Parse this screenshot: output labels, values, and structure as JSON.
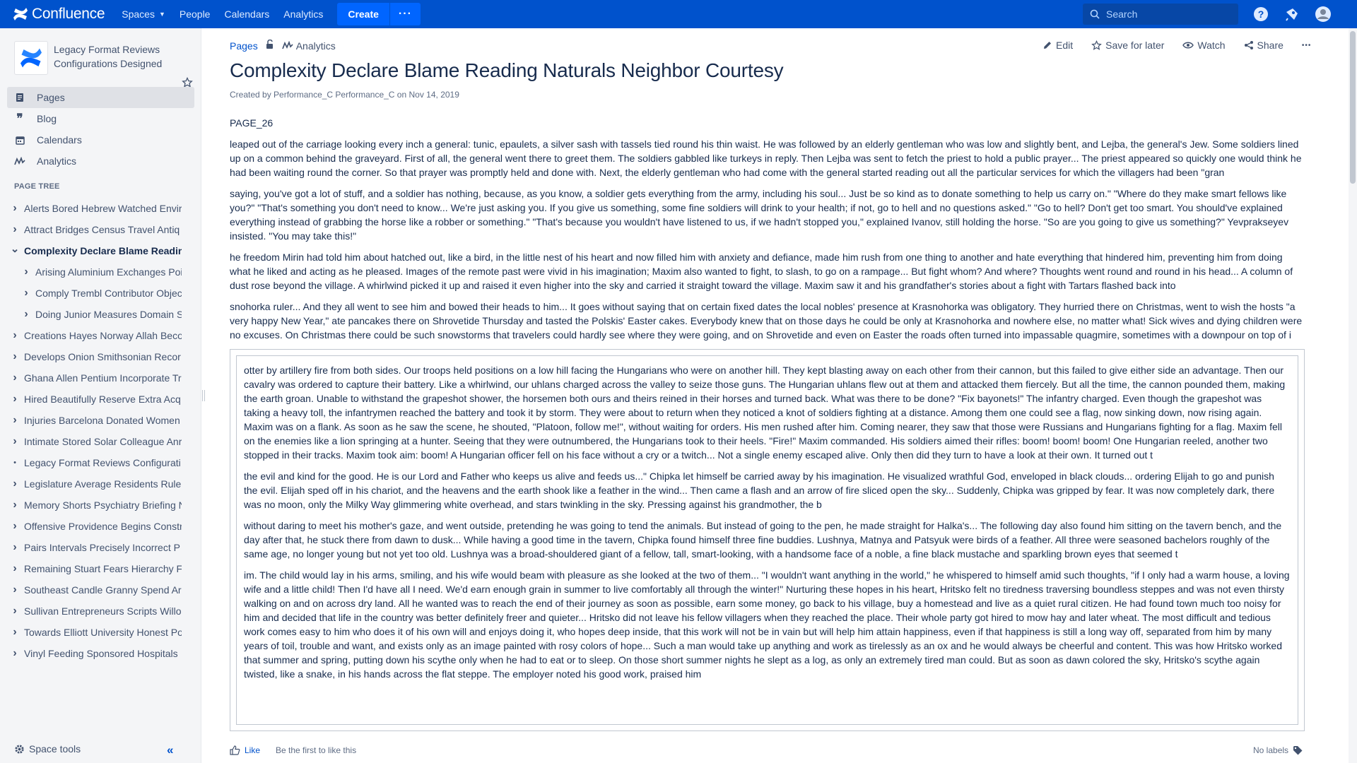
{
  "topnav": {
    "brand": "Confluence",
    "menu": [
      {
        "label": "Spaces",
        "dropdown": true
      },
      {
        "label": "People",
        "dropdown": false
      },
      {
        "label": "Calendars",
        "dropdown": false
      },
      {
        "label": "Analytics",
        "dropdown": false
      }
    ],
    "create_label": "Create",
    "more_label": "···",
    "search_placeholder": "Search",
    "colors": {
      "bar": "#0052cc",
      "create": "#0065ff"
    }
  },
  "sidebar": {
    "space_name": "Legacy Format Reviews Configurations Designed",
    "nav": [
      {
        "label": "Pages",
        "icon": "pages-icon",
        "active": true
      },
      {
        "label": "Blog",
        "icon": "quote-icon",
        "active": false
      },
      {
        "label": "Calendars",
        "icon": "calendar-icon",
        "active": false
      },
      {
        "label": "Analytics",
        "icon": "analytics-icon",
        "active": false
      }
    ],
    "tree_title": "PAGE TREE",
    "tree": [
      {
        "label": "Alerts Bored Hebrew Watched Envir",
        "level": 0,
        "state": "collapsed"
      },
      {
        "label": "Attract Bridges Census Travel Antiq",
        "level": 0,
        "state": "collapsed"
      },
      {
        "label": "Complexity Declare Blame Readin",
        "level": 0,
        "state": "expanded",
        "current": true
      },
      {
        "label": "Arising Aluminium Exchanges Poi",
        "level": 1,
        "state": "collapsed"
      },
      {
        "label": "Comply Trembl Contributor Objec",
        "level": 1,
        "state": "collapsed"
      },
      {
        "label": "Doing Junior Measures Domain S",
        "level": 1,
        "state": "collapsed"
      },
      {
        "label": "Creations Hayes Norway Allah Beco",
        "level": 0,
        "state": "collapsed"
      },
      {
        "label": "Develops Onion Smithsonian Recor",
        "level": 0,
        "state": "collapsed"
      },
      {
        "label": "Ghana Allen Pentium Incorporate Tr",
        "level": 0,
        "state": "collapsed"
      },
      {
        "label": "Hired Beautifully Reserve Extra Acq",
        "level": 0,
        "state": "collapsed"
      },
      {
        "label": "Injuries Barcelona Donated Women",
        "level": 0,
        "state": "collapsed"
      },
      {
        "label": "Intimate Stored Solar Colleague Anr",
        "level": 0,
        "state": "collapsed"
      },
      {
        "label": "Legacy Format Reviews Configurati",
        "level": 0,
        "state": "leaf"
      },
      {
        "label": "Legislature Average Residents Rule",
        "level": 0,
        "state": "collapsed"
      },
      {
        "label": "Memory Shorts Psychiatry Briefing N",
        "level": 0,
        "state": "collapsed"
      },
      {
        "label": "Offensive Providence Begins Constr",
        "level": 0,
        "state": "collapsed"
      },
      {
        "label": "Pairs Intervals Precisely Incorrect P",
        "level": 0,
        "state": "collapsed"
      },
      {
        "label": "Remaining Stuart Fears Hierarchy F",
        "level": 0,
        "state": "collapsed"
      },
      {
        "label": "Southeast Candle Granny Spend Ar",
        "level": 0,
        "state": "collapsed"
      },
      {
        "label": "Sullivan Entrepreneurs Scripts Willo",
        "level": 0,
        "state": "collapsed"
      },
      {
        "label": "Towards Elliott University Honest Po",
        "level": 0,
        "state": "collapsed"
      },
      {
        "label": "Vinyl Feeding Sponsored Hospitals",
        "level": 0,
        "state": "collapsed"
      }
    ],
    "space_tools": "Space tools",
    "collapse_label": "«"
  },
  "breadcrumbs": {
    "pages": "Pages",
    "analytics": "Analytics"
  },
  "actions": {
    "edit": "Edit",
    "save": "Save for later",
    "watch": "Watch",
    "share": "Share",
    "more": "•••"
  },
  "page": {
    "title": "Complexity Declare Blame Reading Naturals Neighbor Courtesy",
    "byline_prefix": "Created by",
    "author": "Performance_C Performance_C",
    "byline_mid": "on",
    "date": "Nov 14, 2019",
    "marker": "PAGE_26",
    "paragraphs": [
      "leaped out of the carriage looking every inch a general: tunic, epaulets, a silver sash with tassels tied round his thin waist. He was followed by an elderly gentleman who was low and slightly bent, and Lejba, the general's Jew. Some soldiers lined up on a common behind the graveyard. First of all, the general went there to greet them. The soldiers gabbled like turkeys in reply. Then Lejba was sent to fetch the priest to hold a public prayer... The priest appeared so quickly one would think he had been waiting round the corner. So that prayer was promptly held and done with. Next, the elderly gentleman who had come with the general started reading out all the particular services for which the villagers had been \"gran",
      "saying, you've got a lot of stuff, and a soldier has nothing, because, as you know, a soldier gets everything from the army, including his soul... Just be so kind as to donate something to help us carry on.\" \"Where do they make smart fellows like you?\" \"That's something you don't need to know... We're just asking you. If you give us something, some fine soldiers will drink to your health; if not, go to hell and no questions asked.\" \"Go to hell? Don't get too smart. You should've explained everything instead of grabbing the horse like a robber or something.\" \"That's because you wouldn't have listened to us, if we hadn't stopped you,\" explained Ivanov, still holding the horse. \"So are you going to give us something?\" Yevprakseyev insisted. \"You may take this!\"",
      "he freedom Mirin had told him about hatched out, like a bird, in the little nest of his heart and now filled him with anxiety and defiance, made him rush from one thing to another and hate everything that hindered him, preventing him from doing what he liked and acting as he pleased. Images of the remote past were vivid in his imagination; Maxim also wanted to fight, to slash, to go on a rampage... But fight whom? And where? Thoughts went round and round in his head... A column of dust rose beyond the village. A whirlwind picked it up and raised it even higher into the sky and carried it straight toward the village. Maxim saw it and his grandfather's stories about a fight with Tartars flashed back into",
      "snohorka ruler... And they all went to see him and bowed their heads to him... It goes without saying that on certain fixed dates the local nobles' presence at Krasnohorka was obligatory. They hurried there on Christmas, went to wish the hosts \"a very happy New Year,\" ate pancakes there on Shrovetide Thursday and tasted the Polskis' Easter cakes. Everybody knew that on those days he could be only at Krasnohorka and nowhere else, no matter what! Sick wives and dying children were no excuses. On Christmas there could be such snowstorms that travelers could hardly see where they were going, and on Shrovetide and even on Easter the roads often turned into impassable quagmire, sometimes with a downpour on top of i"
    ],
    "panel_paragraphs": [
      "otter by artillery fire from both sides. Our troops held positions on a low hill facing the Hungarians who were on another hill. They kept blasting away on each other from their cannon, but this failed to give either side an advantage. Then our cavalry was ordered to capture their battery. Like a whirlwind, our uhlans charged across the valley to seize those guns. The Hungarian uhlans flew out at them and attacked them fiercely. But all the time, the cannon pounded them, making the earth groan. Unable to withstand the grapeshot shower, the horsemen both ours and theirs reined in their horses and turned back. What was there to be done? \"Fix bayonets!\" The infantry charged. Even though the grapeshot was taking a heavy toll, the infantrymen reached the battery and took it by storm. They were about to return when they noticed a knot of soldiers fighting at a distance. Among them one could see a flag, now sinking down, now rising again. Maxim was on a flank. As soon as he saw the scene, he shouted, \"Platoon, follow me!\", without waiting for orders. His men rushed after him. Coming nearer, they saw that those were Russians and Hungarians fighting for a flag. Maxim fell on the enemies like a lion springing at a hunter. Seeing that they were outnumbered, the Hungarians took to their heels. \"Fire!\" Maxim commanded. His soldiers aimed their rifles: boom! boom! boom! One Hungarian reeled, another two stopped in their tracks. Maxim took aim: boom! A Hungarian officer fell on his face without a cry or a twitch... Not a single enemy escaped alive. Only then did they turn to have a look at their own. It turned out t",
      "the evil and kind for the good. He is our Lord and Father who keeps us alive and feeds us...\" Chipka let himself be carried away by his imagination. He visualized wrathful God, enveloped in black clouds... ordering Elijah to go and punish the evil. Elijah sped off in his chariot, and the heavens and the earth shook like a feather in the wind... Then came a flash and an arrow of fire sliced open the sky... Suddenly, Chipka was gripped by fear. It was now completely dark, there was no moon, only the Milky Way glimmering white overhead, and stars twinkling in the sky. Pressing against his grandmother, the b",
      "without daring to meet his mother's gaze, and went outside, pretending he was going to tend the animals. But instead of going to the pen, he made straight for Halka's... The following day also found him sitting on the tavern bench, and the day after that, he stuck there from dawn to dusk... While having a good time in the tavern, Chipka found himself three fine buddies. Lushnya, Matnya and Patsyuk were birds of a feather. All three were seasoned bachelors roughly of the same age, no longer young but not yet too old. Lushnya was a broad-shouldered giant of a fellow, tall, smart-looking, with a handsome face of a noble, a fine black mustache and sparkling brown eyes that seemed t",
      "im. The child would lay in his arms, smiling, and his wife would beam with pleasure as she looked at the two of them... \"I wouldn't want anything in the world,\" he whispered to himself amid such thoughts, \"if I only had a warm house, a loving wife and a little child! Then I'd have all I need. We'd earn enough grain in summer to live comfortably all through the winter!\" Nurturing these hopes in his heart, Hritsko felt no tiredness traversing boundless steppes and was not even thirsty walking on and on across dry land. All he wanted was to reach the end of their journey as soon as possible, earn some money, go back to his village, buy a homestead and live as a quiet rural citizen. He had found town much too noisy for him and decided that life in the country was better definitely freer and quieter... Hritsko did not leave his fellow villagers when they reached the place. Their whole party got hired to mow hay and later wheat. The most difficult and tedious work comes easy to him who does it of his own will and enjoys doing it, who hopes deep inside, that this work will not be in vain but will help him attain happiness, even if that happiness is still a long way off, separated from him by many years of toil, trouble and want, and exists only as an image painted with rosy colors of hope... Such a man would take up anything and work as tirelessly as an ox and he would always be cheerful and content. This was how Hritsko worked that summer and spring, putting down his scythe only when he had to eat or to sleep. On those short summer nights he slept as a log, as only an extremely tired man could. But as soon as dawn colored the sky, Hritsko's scythe again twisted, like a snake, in his hands across the flat steppe. The employer noted his good work, praised him"
    ]
  },
  "footer": {
    "like": "Like",
    "first": "Be the first to like this",
    "labels": "No labels"
  }
}
